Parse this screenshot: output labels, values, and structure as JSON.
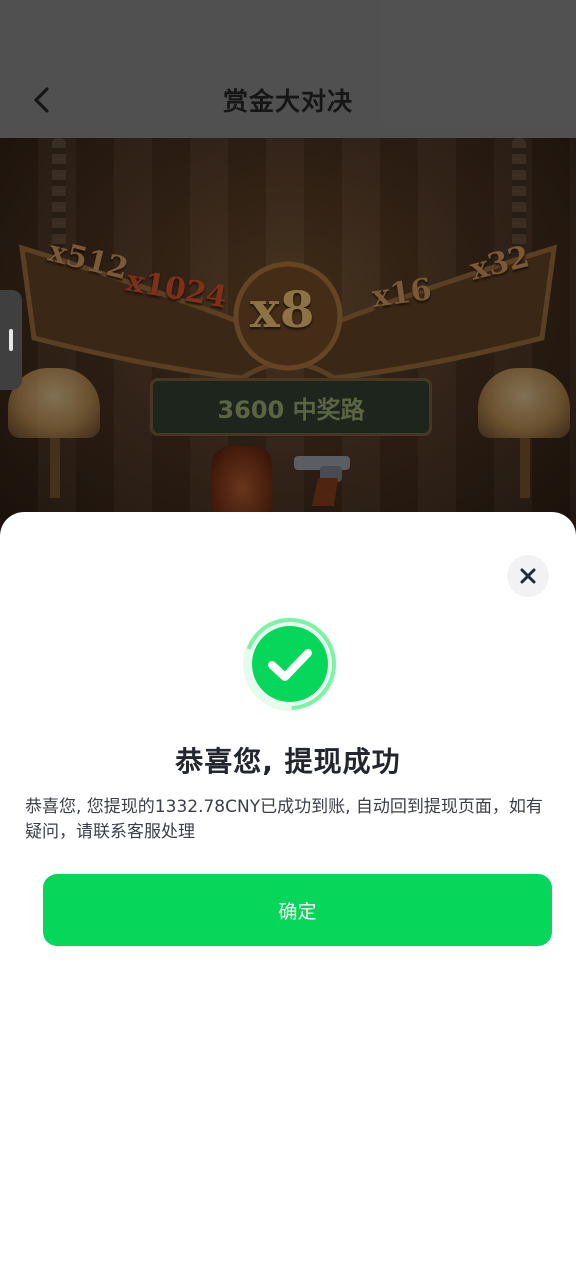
{
  "header": {
    "title": "赏金大对决",
    "back_icon": "chevron-left-icon"
  },
  "game": {
    "multipliers": [
      "x512",
      "x1024",
      "x8",
      "x16",
      "x32"
    ],
    "ways_text": "3600 中奖路"
  },
  "dialog": {
    "close_icon": "close-icon",
    "success_icon": "check-circle-icon",
    "title": "恭喜您, 提现成功",
    "message": "恭喜您, 您提现的1332.78CNY已成功到账, 自动回到提现页面，如有疑问，请联系客服处理",
    "confirm_label": "确定",
    "accent_color": "#06d65a"
  }
}
